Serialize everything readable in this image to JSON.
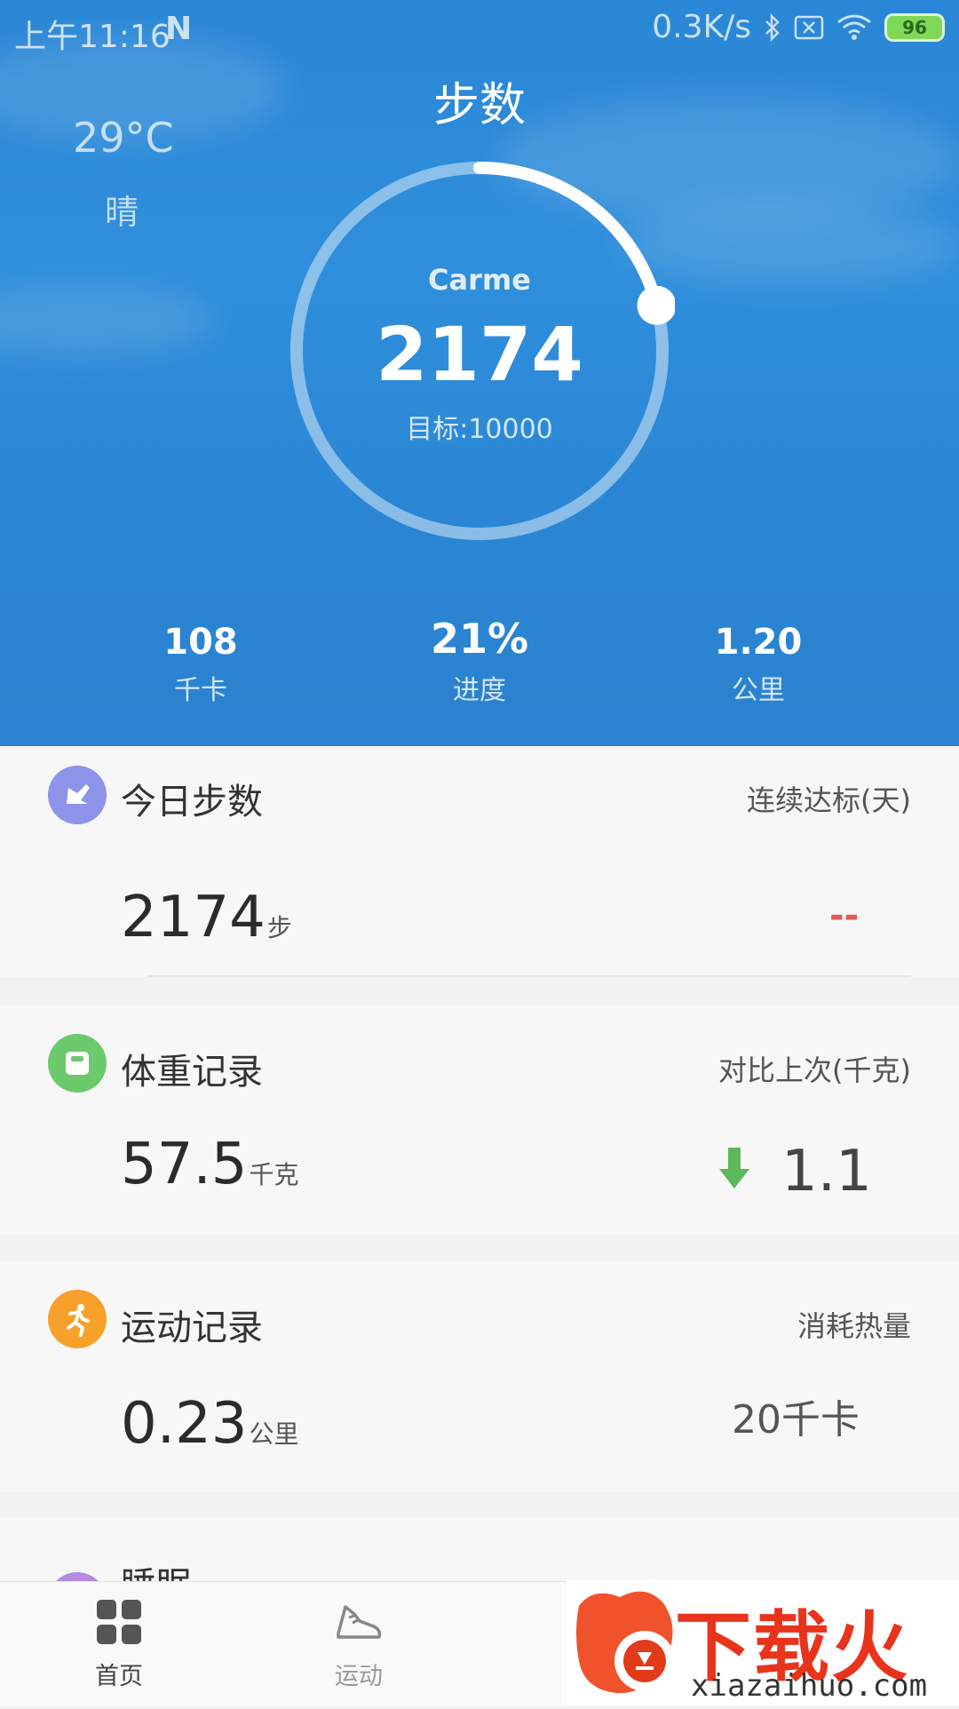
{
  "status_bar": {
    "time": "上午11:16",
    "n_icon": "N",
    "net_speed": "0.3K/s",
    "battery": "96"
  },
  "hero": {
    "title": "步数",
    "weather": {
      "temp": "29°C",
      "condition": "晴"
    },
    "ring": {
      "name": "Carme",
      "steps": "2174",
      "goal": "目标:10000",
      "progress": 0.21
    },
    "stats": [
      {
        "value": "108",
        "label": "千卡"
      },
      {
        "value": "21%",
        "label": "进度"
      },
      {
        "value": "1.20",
        "label": "公里"
      }
    ]
  },
  "cards": {
    "steps": {
      "title": "今日步数",
      "subtitle": "连续达标(天)",
      "value": "2174",
      "unit": "步",
      "right": "--"
    },
    "weight": {
      "title": "体重记录",
      "subtitle": "对比上次(千克)",
      "value": "57.5",
      "unit": "千克",
      "right": "1.1"
    },
    "exercise": {
      "title": "运动记录",
      "subtitle": "消耗热量",
      "value": "0.23",
      "unit": "公里",
      "right": "20千卡"
    },
    "sleep": {
      "title": "睡眠"
    }
  },
  "nav": [
    {
      "label": "首页",
      "icon": "grid-icon"
    },
    {
      "label": "运动",
      "icon": "shoe-icon"
    }
  ],
  "watermark": {
    "brand": "下载火",
    "url": "xiazaihuo.com"
  },
  "colors": {
    "hero": "#2f8fdc",
    "steps_icon": "#8c93e8",
    "weight_icon": "#6cc96c",
    "exercise_icon": "#f7a12a",
    "arrow": "#5cb85c",
    "dash": "#e05a5a"
  }
}
